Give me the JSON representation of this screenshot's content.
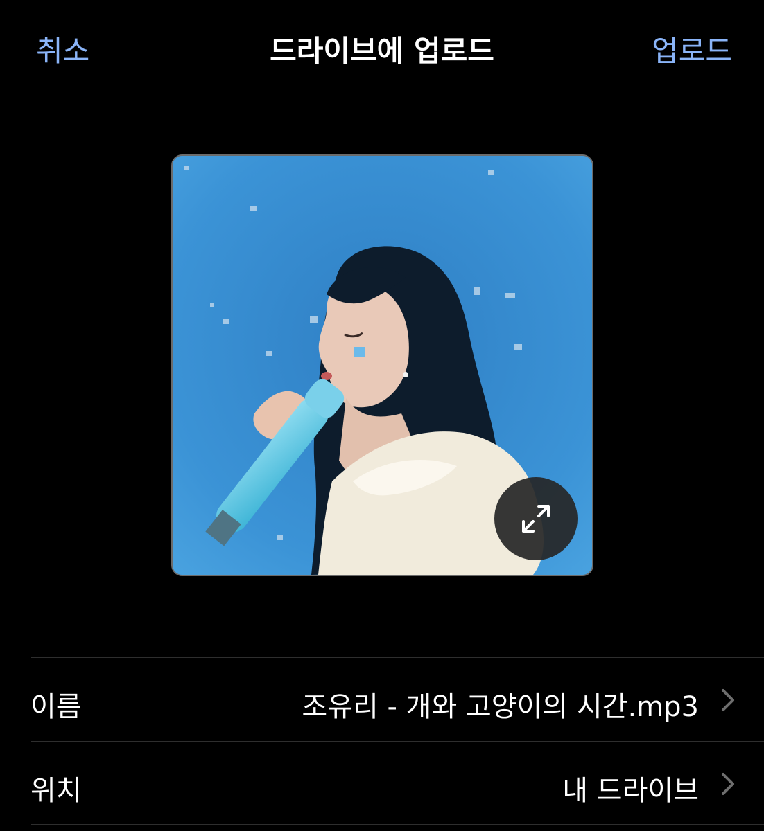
{
  "nav": {
    "cancel_label": "취소",
    "title": "드라이브에 업로드",
    "upload_label": "업로드"
  },
  "preview": {
    "icon": "expand-icon",
    "subject": "album-art-singer-with-microphone"
  },
  "details": [
    {
      "label": "이름",
      "value": "조유리 - 개와 고양이의 시간.mp3",
      "icon": "chevron-right-icon"
    },
    {
      "label": "위치",
      "value": "내 드라이브",
      "icon": "chevron-right-icon"
    }
  ],
  "colors": {
    "accent": "#8ab4f8",
    "background": "#000000",
    "divider": "#2e2e2e",
    "chevron": "#6e6e6e"
  }
}
